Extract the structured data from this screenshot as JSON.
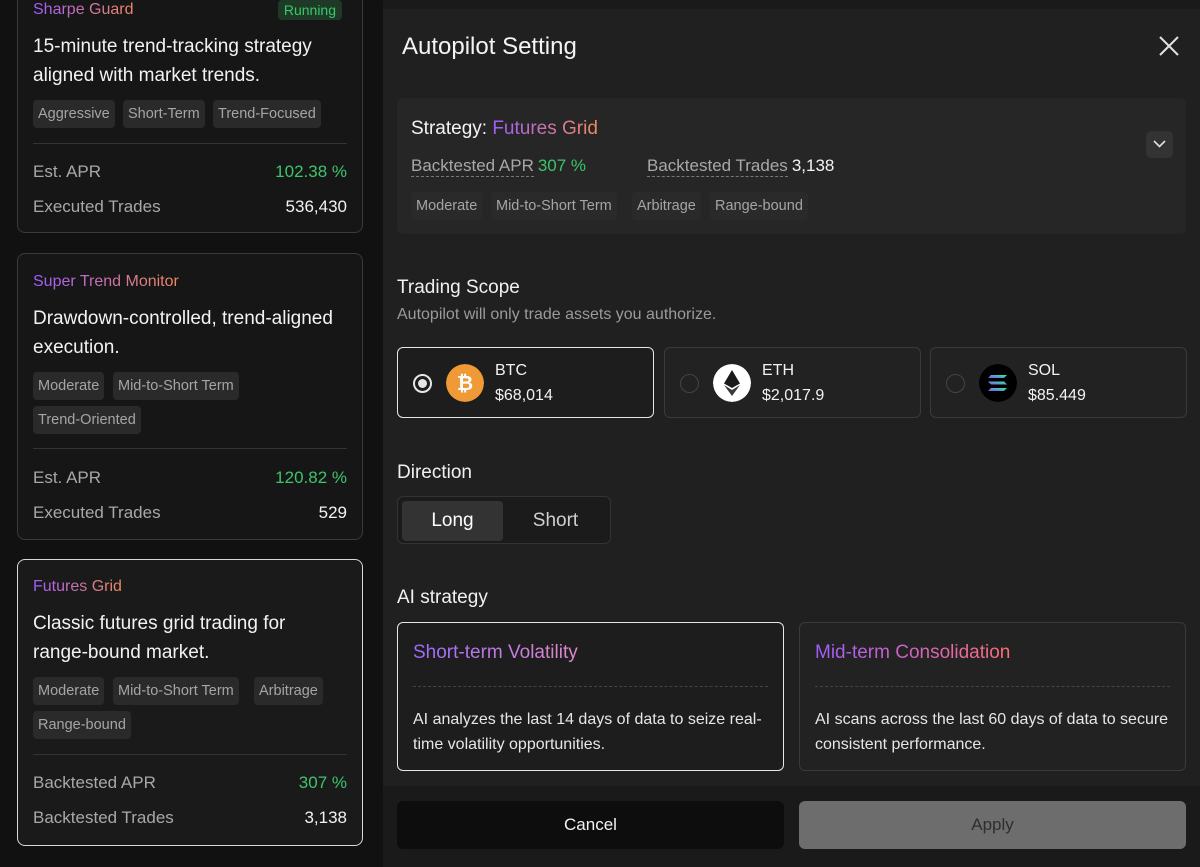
{
  "left_cards": [
    {
      "name": "Sharpe Guard",
      "badge": "Running",
      "desc": "15-minute trend-tracking strategy aligned with market trends.",
      "tags": [
        "Aggressive",
        "Short-Term",
        "Trend-Focused"
      ],
      "stat1_label": "Est. APR",
      "stat1_value": "102.38 %",
      "stat2_label": "Executed Trades",
      "stat2_value": "536,430"
    },
    {
      "name": "Super Trend Monitor",
      "desc": "Drawdown-controlled, trend-aligned execution.",
      "tags": [
        "Moderate",
        "Mid-to-Short Term",
        "Trend-Oriented"
      ],
      "stat1_label": "Est. APR",
      "stat1_value": "120.82 %",
      "stat2_label": "Executed Trades",
      "stat2_value": "529"
    },
    {
      "name": "Futures Grid",
      "desc": "Classic futures grid trading for range-bound market.",
      "tags": [
        "Moderate",
        "Mid-to-Short Term",
        "Arbitrage",
        "Range-bound"
      ],
      "stat1_label": "Backtested APR",
      "stat1_value": "307 %",
      "stat2_label": "Backtested Trades",
      "stat2_value": "3,138"
    }
  ],
  "modal": {
    "title": "Autopilot Setting",
    "close_icon": "close-icon",
    "strategy": {
      "label": "Strategy:",
      "name": "Futures Grid",
      "apr_label": "Backtested APR",
      "apr_value": "307 %",
      "trades_label": "Backtested Trades",
      "trades_value": "3,138",
      "tags": [
        "Moderate",
        "Mid-to-Short Term",
        "Arbitrage",
        "Range-bound"
      ]
    },
    "trading_scope": {
      "title": "Trading Scope",
      "subtitle": "Autopilot will only trade assets you authorize.",
      "coins": [
        {
          "symbol": "BTC",
          "price": "$68,014",
          "selected": true,
          "icon": "bitcoin-icon",
          "color": "#f09a37"
        },
        {
          "symbol": "ETH",
          "price": "$2,017.9",
          "selected": false,
          "icon": "ethereum-icon",
          "color": "#ffffff"
        },
        {
          "symbol": "SOL",
          "price": "$85.449",
          "selected": false,
          "icon": "solana-icon",
          "color": "#000000"
        }
      ]
    },
    "direction": {
      "title": "Direction",
      "options": [
        "Long",
        "Short"
      ],
      "selected": "Long"
    },
    "ai_strategy": {
      "title": "AI strategy",
      "options": [
        {
          "title": "Short-term Volatility",
          "desc": "AI analyzes the last 14 days of data to seize real-time volatility opportunities.",
          "selected": true
        },
        {
          "title": "Mid-term Consolidation",
          "desc": "AI scans across the last 60 days of data to secure consistent performance.",
          "selected": false
        }
      ]
    },
    "footer": {
      "cancel_label": "Cancel",
      "apply_label": "Apply"
    }
  },
  "colors": {
    "green": "#3dc46c",
    "gradient_start": "#a15cff",
    "gradient_end": "#f08a5d",
    "panel_bg": "#202020"
  }
}
